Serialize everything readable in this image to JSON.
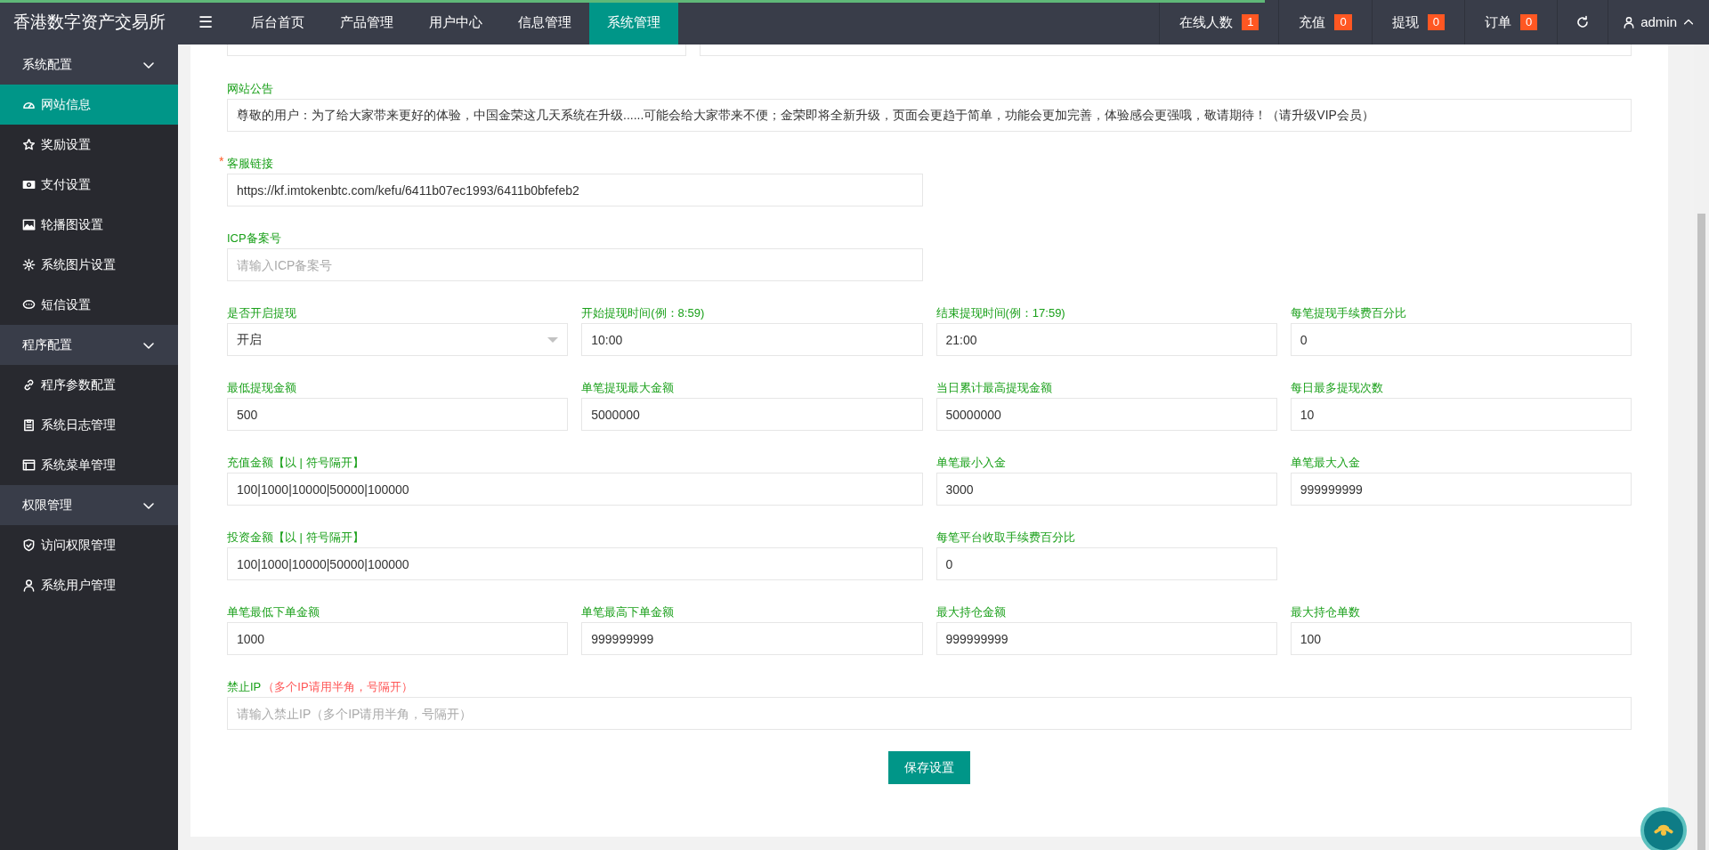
{
  "loading_bar": {
    "level": 0.74
  },
  "header": {
    "title": "香港数字资产交易所",
    "menu_icon": "☰",
    "tabs": [
      {
        "label": "后台首页",
        "selected": false
      },
      {
        "label": "产品管理",
        "selected": false
      },
      {
        "label": "用户中心",
        "selected": false
      },
      {
        "label": "信息管理",
        "selected": false
      },
      {
        "label": "系统管理",
        "selected": true
      }
    ],
    "counters": [
      {
        "label": "在线人数",
        "badge": "1"
      },
      {
        "label": "充值",
        "badge": "0"
      },
      {
        "label": "提现",
        "badge": "0"
      },
      {
        "label": "订单",
        "badge": "0"
      }
    ],
    "user": "admin"
  },
  "sidebar": {
    "groups": [
      {
        "label": "系统配置",
        "expanded": true,
        "items": [
          {
            "label": "网站信息",
            "selected": true
          },
          {
            "label": "奖励设置",
            "selected": false
          },
          {
            "label": "支付设置",
            "selected": false
          },
          {
            "label": "轮播图设置",
            "selected": false
          },
          {
            "label": "系统图片设置",
            "selected": false
          },
          {
            "label": "短信设置",
            "selected": false
          }
        ]
      },
      {
        "label": "程序配置",
        "expanded": true,
        "items": [
          {
            "label": "程序参数配置",
            "selected": false
          },
          {
            "label": "系统日志管理",
            "selected": false
          },
          {
            "label": "系统菜单管理",
            "selected": false
          }
        ]
      },
      {
        "label": "权限管理",
        "expanded": true,
        "items": [
          {
            "label": "访问权限管理",
            "selected": false
          },
          {
            "label": "系统用户管理",
            "selected": false
          }
        ]
      }
    ]
  },
  "form": {
    "rows": [
      [
        {
          "label": "网站公告",
          "kind": "text",
          "value": "尊敬的用户：为了给大家带来更好的体验，中国金荣这几天系统在升级......可能会给大家带来不便；金荣即将全新升级，页面会更趋于简单，功能会更加完善，体验感会更强哦，敬请期待！（请升级VIP会员）"
        }
      ],
      [
        {
          "label": "客服链接",
          "required_mark": "*",
          "kind": "text",
          "value": "https://kf.imtokenbtc.com/kefu/6411b07ec1993/6411b0bfefeb2"
        }
      ],
      [
        {
          "label": "ICP备案号",
          "kind": "text",
          "placeholder": "请输入ICP备案号"
        }
      ],
      [
        {
          "label": "是否开启提现",
          "kind": "select",
          "value": "开启"
        },
        {
          "label": "开始提现时间(例：8:59)",
          "kind": "text",
          "value": "10:00"
        },
        {
          "label": "结束提现时间(例：17:59)",
          "kind": "text",
          "value": "21:00"
        },
        {
          "label": "每笔提现手续费百分比",
          "kind": "text",
          "value": "0"
        }
      ],
      [
        {
          "label": "最低提现金额",
          "kind": "text",
          "value": "500"
        },
        {
          "label": "单笔提现最大金额",
          "kind": "text",
          "value": "5000000"
        },
        {
          "label": "当日累计最高提现金额",
          "kind": "text",
          "value": "50000000"
        },
        {
          "label": "每日最多提现次数",
          "kind": "text",
          "value": "10"
        }
      ],
      [
        {
          "label": "充值金额【以 | 符号隔开】",
          "kind": "text",
          "value": "100|1000|10000|50000|100000"
        },
        "",
        {
          "label": "单笔最小入金",
          "kind": "text",
          "value": "3000"
        },
        {
          "label": "单笔最大入金",
          "kind": "text",
          "value": "999999999"
        }
      ],
      [
        {
          "label": "投资金额【以 | 符号隔开】",
          "kind": "text",
          "value": "100|1000|10000|50000|100000"
        },
        "",
        {
          "label": "每笔平台收取手续费百分比",
          "kind": "text",
          "value": "0"
        }
      ],
      [
        {
          "label": "单笔最低下单金额",
          "kind": "text",
          "value": "1000"
        },
        {
          "label": "单笔最高下单金额",
          "kind": "text",
          "value": "999999999"
        },
        {
          "label": "最大持仓金额",
          "kind": "text",
          "value": "999999999"
        },
        {
          "label": "最大持仓单数",
          "kind": "text",
          "value": "100"
        }
      ],
      [
        {
          "label": "禁止IP",
          "hint": "（多个IP请用半角，号隔开）",
          "kind": "text",
          "placeholder": "请输入禁止IP（多个IP请用半角，号隔开）"
        }
      ]
    ],
    "save_button": "保存设置"
  }
}
